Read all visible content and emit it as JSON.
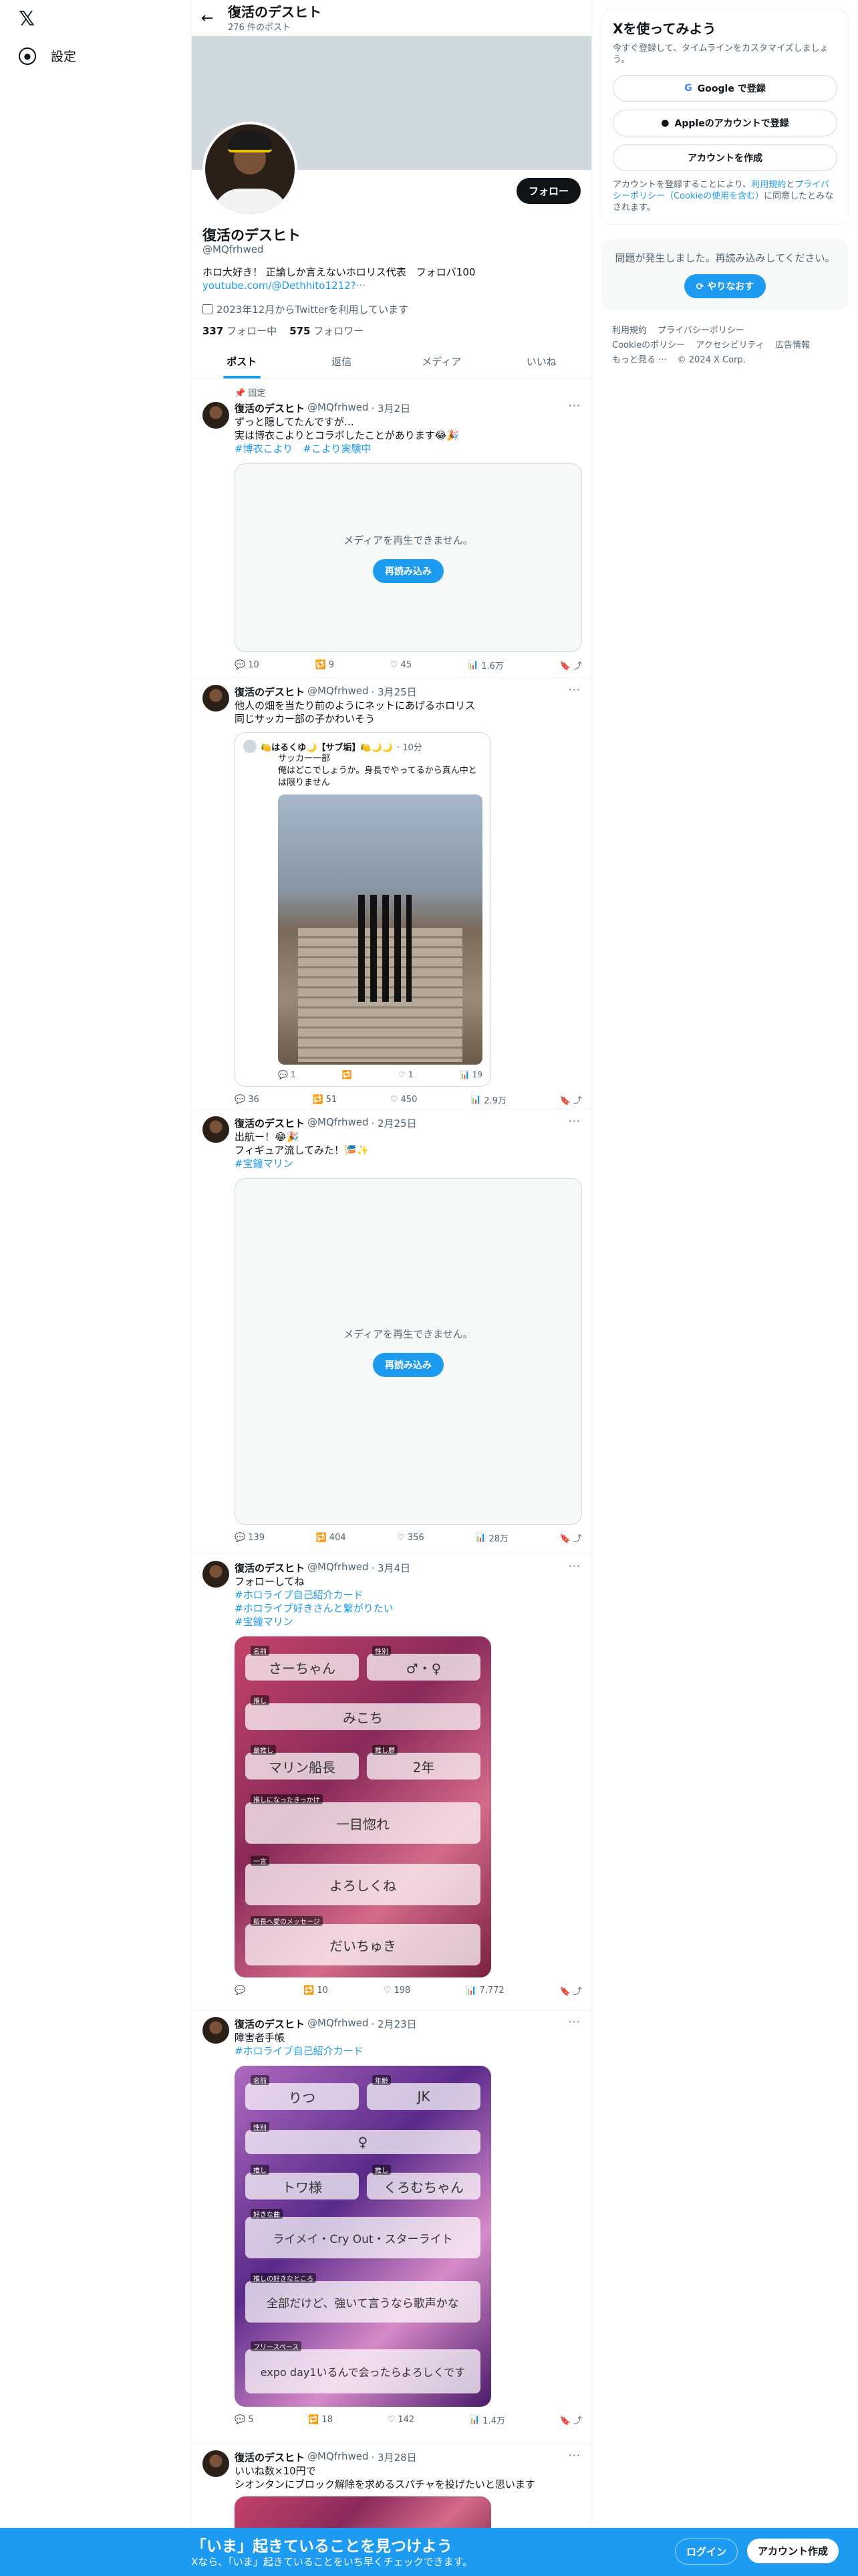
{
  "nav": {
    "logo": "𝕏",
    "settings": "設定"
  },
  "header": {
    "title": "復活のデスヒト",
    "post_count": "276 件のポスト"
  },
  "profile": {
    "name": "復活のデスヒト",
    "handle": "@MQfrhwed",
    "bio": "ホロ大好き！ 正論しか言えないホロリス代表　フォロバ100",
    "link": "youtube.com/@Dethhito1212?···",
    "joined": "2023年12月からTwitterを利用しています",
    "following_count": "337",
    "following_label": "フォロー中",
    "followers_count": "575",
    "followers_label": "フォロワー",
    "follow_button": "フォロー"
  },
  "tabs": [
    "ポスト",
    "返信",
    "メディア",
    "いいね"
  ],
  "tweets": [
    {
      "pinned": "固定",
      "name": "復活のデスヒト",
      "handle": "@MQfrhwed",
      "date": "· 3月2日",
      "lines": [
        "ずっと隠してたんですが…",
        "実は博衣こよりとコラボしたことがあります😂🎉"
      ],
      "tags": "#博衣こより　#こより実験中",
      "media_error": "メディアを再生できません。",
      "reload": "再読み込み",
      "replies": "10",
      "reposts": "9",
      "likes": "45",
      "views": "1.6万"
    },
    {
      "name": "復活のデスヒト",
      "handle": "@MQfrhwed",
      "date": "· 3月25日",
      "lines": [
        "他人の畑を当たり前のようにネットにあげるホロリス",
        "同じサッカー部の子かわいそう"
      ],
      "quote": {
        "name": "🍋はるくゆ🌙【サブ垢】🍋🌙🌙",
        "time": "· 10分",
        "lines": [
          "サッカー一部",
          "俺はどこでしょうか。身長でやってるから真ん中とは限りません"
        ],
        "replies": "1",
        "reposts": "",
        "likes": "1",
        "views": "19"
      },
      "replies": "36",
      "reposts": "51",
      "likes": "450",
      "views": "2.9万"
    },
    {
      "name": "復活のデスヒト",
      "handle": "@MQfrhwed",
      "date": "· 2月25日",
      "lines": [
        "出航ー！😂🎉",
        "フィギュア流してみた！🎏✨"
      ],
      "tags": "#宝鐘マリン",
      "media_error": "メディアを再生できません。",
      "reload": "再読み込み",
      "replies": "139",
      "reposts": "404",
      "likes": "356",
      "views": "28万"
    },
    {
      "name": "復活のデスヒト",
      "handle": "@MQfrhwed",
      "date": "· 3月4日",
      "lines": [
        "フォローしてね"
      ],
      "tags_list": [
        "#ホロライブ自己紹介カード",
        "#ホロライブ好きさんと繋がりたい",
        "#宝鐘マリン"
      ],
      "card": {
        "l1": "名前",
        "v1": "さーちゃん",
        "l2": "性別",
        "v2": "♂・♀",
        "l3": "推し",
        "v3": "みこち",
        "l4": "最推し",
        "v4": "マリン船長",
        "l5": "推し歴",
        "v5": "2年",
        "l6": "推しになったきっかけ",
        "v6": "一目惚れ",
        "l7": "一言",
        "v7": "よろしくね",
        "l8": "船長へ愛のメッセージ",
        "v8": "だいちゅき"
      },
      "replies": "",
      "reposts": "10",
      "likes": "198",
      "views": "7,772"
    },
    {
      "name": "復活のデスヒト",
      "handle": "@MQfrhwed",
      "date": "· 2月23日",
      "lines": [
        "障害者手帳"
      ],
      "tags_list": [
        "#ホロライブ自己紹介カード"
      ],
      "card": {
        "l1": "名前",
        "v1": "りつ",
        "l2": "年齢",
        "v2": "JK",
        "l3": "性別",
        "v3": "♀",
        "l4": "推し",
        "v4": "トワ様",
        "l5": "推し",
        "v5": "くろむちゃん",
        "l6": "好きな曲",
        "v6": "ライメイ・Cry Out・スターライト",
        "l7": "推しの好きなところ",
        "v7": "全部だけど、強いて言うなら歌声かな",
        "l8": "フリースペース",
        "v8": "expo day1いるんで会ったらよろしくです"
      },
      "replies": "5",
      "reposts": "18",
      "likes": "142",
      "views": "1.4万"
    },
    {
      "name": "復活のデスヒト",
      "handle": "@MQfrhwed",
      "date": "· 3月28日",
      "lines": [
        "いいね数×10円で",
        "シオンタンにブロック解除を求めるスパチャを投げたいと思います"
      ]
    }
  ],
  "signup": {
    "title": "Xを使ってみよう",
    "sub": "今すぐ登録して、タイムラインをカスタマイズしましょう。",
    "google": "Google で登録",
    "apple": "Appleのアカウントで登録",
    "create": "アカウントを作成",
    "legal_pre": "アカウントを登録することにより、",
    "legal_terms": "利用規約",
    "legal_and": "と",
    "legal_privacy": "プライバシーポリシー",
    "legal_cookie": "（Cookieの使用を含む）",
    "legal_post": "に同意したとみなされます。"
  },
  "error": {
    "text": "問題が発生しました。再読み込みしてください。",
    "retry": "やりなおす"
  },
  "footer": {
    "links": [
      "利用規約",
      "プライバシーポリシー",
      "Cookieのポリシー",
      "アクセシビリティ",
      "広告情報",
      "もっと見る ···",
      "© 2024 X Corp."
    ]
  },
  "bottom": {
    "title": "「いま」起きていることを見つけよう",
    "sub": "Xなら、「いま」起きていることをいち早くチェックできます。",
    "login": "ログイン",
    "create": "アカウント作成"
  }
}
